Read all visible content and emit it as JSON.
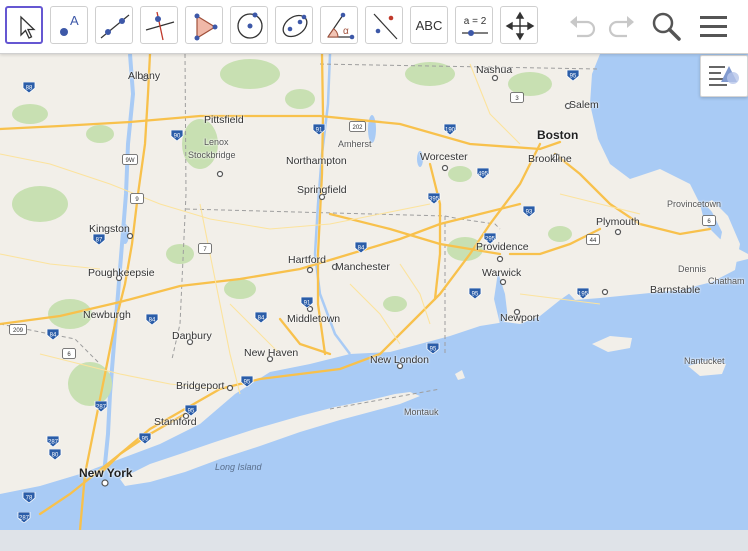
{
  "toolbar": {
    "tools": [
      {
        "name": "move-tool",
        "icon": "cursor-arrow-icon"
      },
      {
        "name": "point-tool",
        "icon": "point-a-icon",
        "label": "A"
      },
      {
        "name": "line-tool",
        "icon": "line-through-points-icon"
      },
      {
        "name": "perpendicular-line-tool",
        "icon": "perpendicular-line-icon"
      },
      {
        "name": "polygon-tool",
        "icon": "polygon-icon"
      },
      {
        "name": "circle-tool",
        "icon": "circle-center-point-icon"
      },
      {
        "name": "ellipse-tool",
        "icon": "ellipse-icon"
      },
      {
        "name": "angle-tool",
        "icon": "angle-icon",
        "label": "α"
      },
      {
        "name": "reflect-tool",
        "icon": "reflect-about-line-icon"
      },
      {
        "name": "text-tool",
        "icon": "text-icon",
        "label": "ABC"
      },
      {
        "name": "slider-tool",
        "icon": "slider-icon",
        "label": "a = 2"
      },
      {
        "name": "move-graphics-tool",
        "icon": "move-arrows-icon"
      }
    ],
    "undo": "undo-icon",
    "redo": "redo-icon",
    "search": "search-icon",
    "menu": "hamburger-menu-icon",
    "style_bar": "style-bar-toggle-icon"
  },
  "colors": {
    "active_border": "#6557d2",
    "land": "#f2efe9",
    "water": "#a9cbf5",
    "park": "#c8e0b2",
    "highway": "#f8c14c",
    "interstate_shield": "#2b5da8"
  },
  "map": {
    "cities_big": [
      {
        "name": "Boston"
      },
      {
        "name": "New York"
      }
    ],
    "cities_med": [
      {
        "name": "Albany"
      },
      {
        "name": "Nashua"
      },
      {
        "name": "Salem"
      },
      {
        "name": "Worcester"
      },
      {
        "name": "Brookline"
      },
      {
        "name": "Springfield"
      },
      {
        "name": "Hartford"
      },
      {
        "name": "Providence"
      },
      {
        "name": "Warwick"
      },
      {
        "name": "New Haven"
      },
      {
        "name": "Bridgeport"
      },
      {
        "name": "Stamford"
      },
      {
        "name": "Manchester"
      },
      {
        "name": "Middletown"
      },
      {
        "name": "New London"
      },
      {
        "name": "Newport"
      },
      {
        "name": "Danbury"
      },
      {
        "name": "Newburgh"
      },
      {
        "name": "Poughkeepsie"
      },
      {
        "name": "Kingston"
      },
      {
        "name": "Pittsfield"
      },
      {
        "name": "Northampton"
      },
      {
        "name": "Plymouth"
      },
      {
        "name": "Barnstable"
      }
    ],
    "cities_small": [
      {
        "name": "Lenox"
      },
      {
        "name": "Stockbridge"
      },
      {
        "name": "Amherst"
      },
      {
        "name": "Provincetown"
      },
      {
        "name": "Dennis"
      },
      {
        "name": "Chatham"
      },
      {
        "name": "Nantucket"
      },
      {
        "name": "Montauk"
      }
    ],
    "water_labels": [
      {
        "name": "Long Island"
      }
    ],
    "interstates": [
      "88",
      "87",
      "90",
      "91",
      "190",
      "495",
      "95",
      "395",
      "84",
      "91",
      "84",
      "84",
      "84",
      "287",
      "95",
      "287",
      "95",
      "95",
      "295",
      "195",
      "95",
      "80",
      "78",
      "287",
      "93",
      "95"
    ],
    "us_routes": [
      "9W",
      "9",
      "7",
      "202",
      "3",
      "44",
      "6",
      "209",
      "6"
    ]
  }
}
